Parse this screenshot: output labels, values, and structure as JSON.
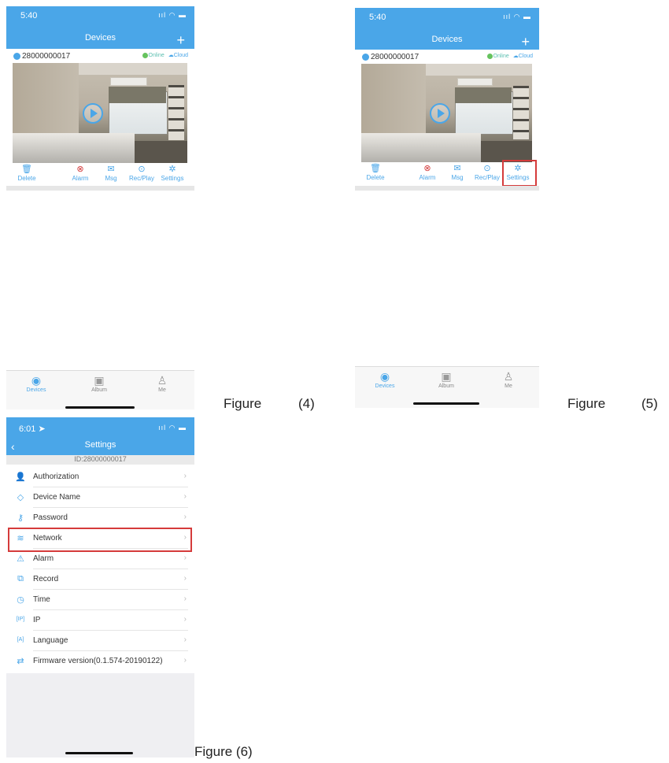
{
  "colors": {
    "accent": "#4aa6e8",
    "alarm": "#d33c3c",
    "online": "#66c35e",
    "highlight": "#d53b3b"
  },
  "figure4": {
    "status_time": "5:40",
    "nav_title": "Devices",
    "add_icon": "+",
    "device_id": "28000000017",
    "online_label": "Online",
    "cloud_label": "Cloud",
    "actions": [
      "Delete",
      "Alarm",
      "Msg",
      "Rec/Play",
      "Settings"
    ],
    "tabs": [
      "Devices",
      "Album",
      "Me"
    ],
    "caption_label": "Figure",
    "caption_number": "(4)"
  },
  "figure5": {
    "status_time": "5:40",
    "nav_title": "Devices",
    "add_icon": "+",
    "device_id": "28000000017",
    "online_label": "Online",
    "cloud_label": "Cloud",
    "actions": [
      "Delete",
      "Alarm",
      "Msg",
      "Rec/Play",
      "Settings"
    ],
    "tabs": [
      "Devices",
      "Album",
      "Me"
    ],
    "caption_label": "Figure",
    "caption_number": "(5)"
  },
  "figure6": {
    "status_time": "6:01",
    "nav_title": "Settings",
    "device_id_line": "ID:28000000017",
    "items": [
      "Authorization",
      "Device Name",
      "Password",
      "Network",
      "Alarm",
      "Record",
      "Time",
      "IP",
      "Language",
      "Firmware version(0.1.574-20190122)"
    ],
    "caption": "Figure (6)"
  },
  "icons": {
    "delete": "trash-icon",
    "alarm": "shield-alarm-icon",
    "msg": "envelope-icon",
    "recplay": "play-circle-icon",
    "settings": "gear-icon",
    "devices": "camera-icon",
    "album": "image-icon",
    "me": "person-icon"
  }
}
